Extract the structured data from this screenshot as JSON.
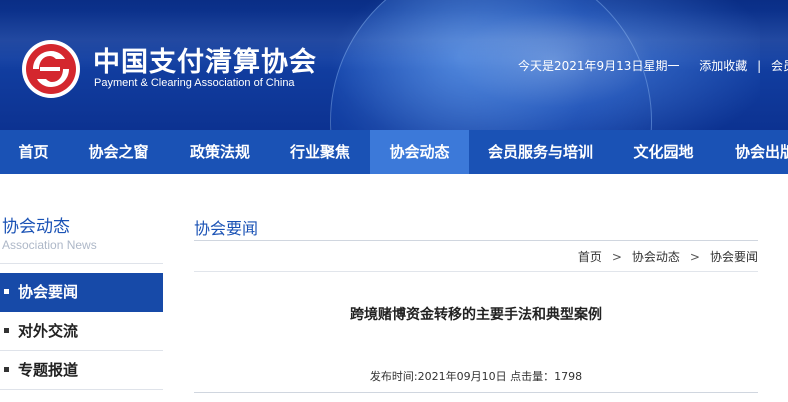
{
  "header": {
    "org_name_cn": "中国支付清算协会",
    "org_name_en": "Payment & Clearing Association of China",
    "date_text": "今天是2021年9月13日星期一",
    "favorite_link": "添加收藏",
    "separator": "|",
    "member_login": "会员登录"
  },
  "nav": {
    "items": [
      {
        "label": "首页"
      },
      {
        "label": "协会之窗"
      },
      {
        "label": "政策法规"
      },
      {
        "label": "行业聚焦"
      },
      {
        "label": "协会动态",
        "active": true
      },
      {
        "label": "会员服务与培训"
      },
      {
        "label": "文化园地"
      },
      {
        "label": "协会出版"
      }
    ]
  },
  "sidebar": {
    "title": "协会动态",
    "subtitle": "Association News",
    "items": [
      {
        "label": "协会要闻",
        "active": true
      },
      {
        "label": "对外交流"
      },
      {
        "label": "专题报道"
      }
    ]
  },
  "main": {
    "section_title": "协会要闻",
    "breadcrumb": [
      "首页",
      "协会动态",
      "协会要闻"
    ],
    "breadcrumb_separator": ">",
    "article_title": "跨境赌博资金转移的主要手法和典型案例",
    "meta": "发布时间:2021年09月10日 点击量：1798"
  },
  "colors": {
    "banner": "#0c3291",
    "nav_bg": "#1a52b5",
    "nav_active": "#3c79d9",
    "sidebar_active": "#174aa8",
    "logo_red": "#d4272e"
  }
}
